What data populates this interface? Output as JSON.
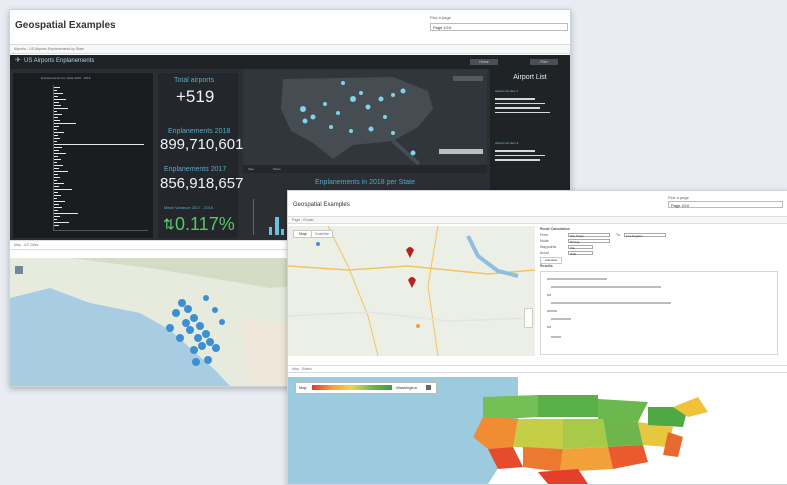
{
  "back": {
    "title": "Geospatial Examples",
    "pick_label": "Pick a page",
    "pick_value": "Page 1/10",
    "tab_label": "Airports - US Airports Enplanements by State",
    "dashboard": {
      "title": "US Airports Enplanements",
      "buttons": [
        "Home",
        "Filter"
      ],
      "bar_chart_title": "Enplanements Per State 2016 - 2018",
      "stats": {
        "total_label": "Total airports",
        "total_value": "+519",
        "enp2018_label": "Enplanements 2018",
        "enp2018_value": "899,710,601",
        "enp2017_label": "Enplanements 2017",
        "enp2017_value": "856,918,657",
        "variance_label": "Mean Variance 2017 - 2018",
        "variance_value": "0.117%"
      },
      "map_footer_tabs": [
        "Map",
        "Show"
      ],
      "lower_chart_title": "Enplanements in 2018 per State",
      "airport_list_title": "Airport List",
      "airport_items": [
        "Airport List item 1",
        "Airport List item 2",
        "Airport List item 3"
      ]
    },
    "light_map_tab": "Map - US Cities"
  },
  "front": {
    "title": "Geospatial Examples",
    "pick_label": "Pick a page",
    "pick_value": "Page 2/10",
    "top_tab": "Page - Router",
    "map_buttons": [
      "Map",
      "Satellite"
    ],
    "details": {
      "heading": "Route Calculation",
      "from_label": "From",
      "from_value": "San Diego",
      "to_label": "To",
      "to_value": "Los Angeles",
      "mode_label": "Mode",
      "mode_value": "Driving",
      "waypoint_label": "Waypoints",
      "waypoint_value": "Via",
      "avoid_label": "Avoid",
      "avoid_value": "Tolls",
      "calc_button": "Calculate",
      "result_label": "Results"
    },
    "bottom_tab": "Map - States",
    "legend_type": "Map",
    "legend_name": "Washington"
  }
}
